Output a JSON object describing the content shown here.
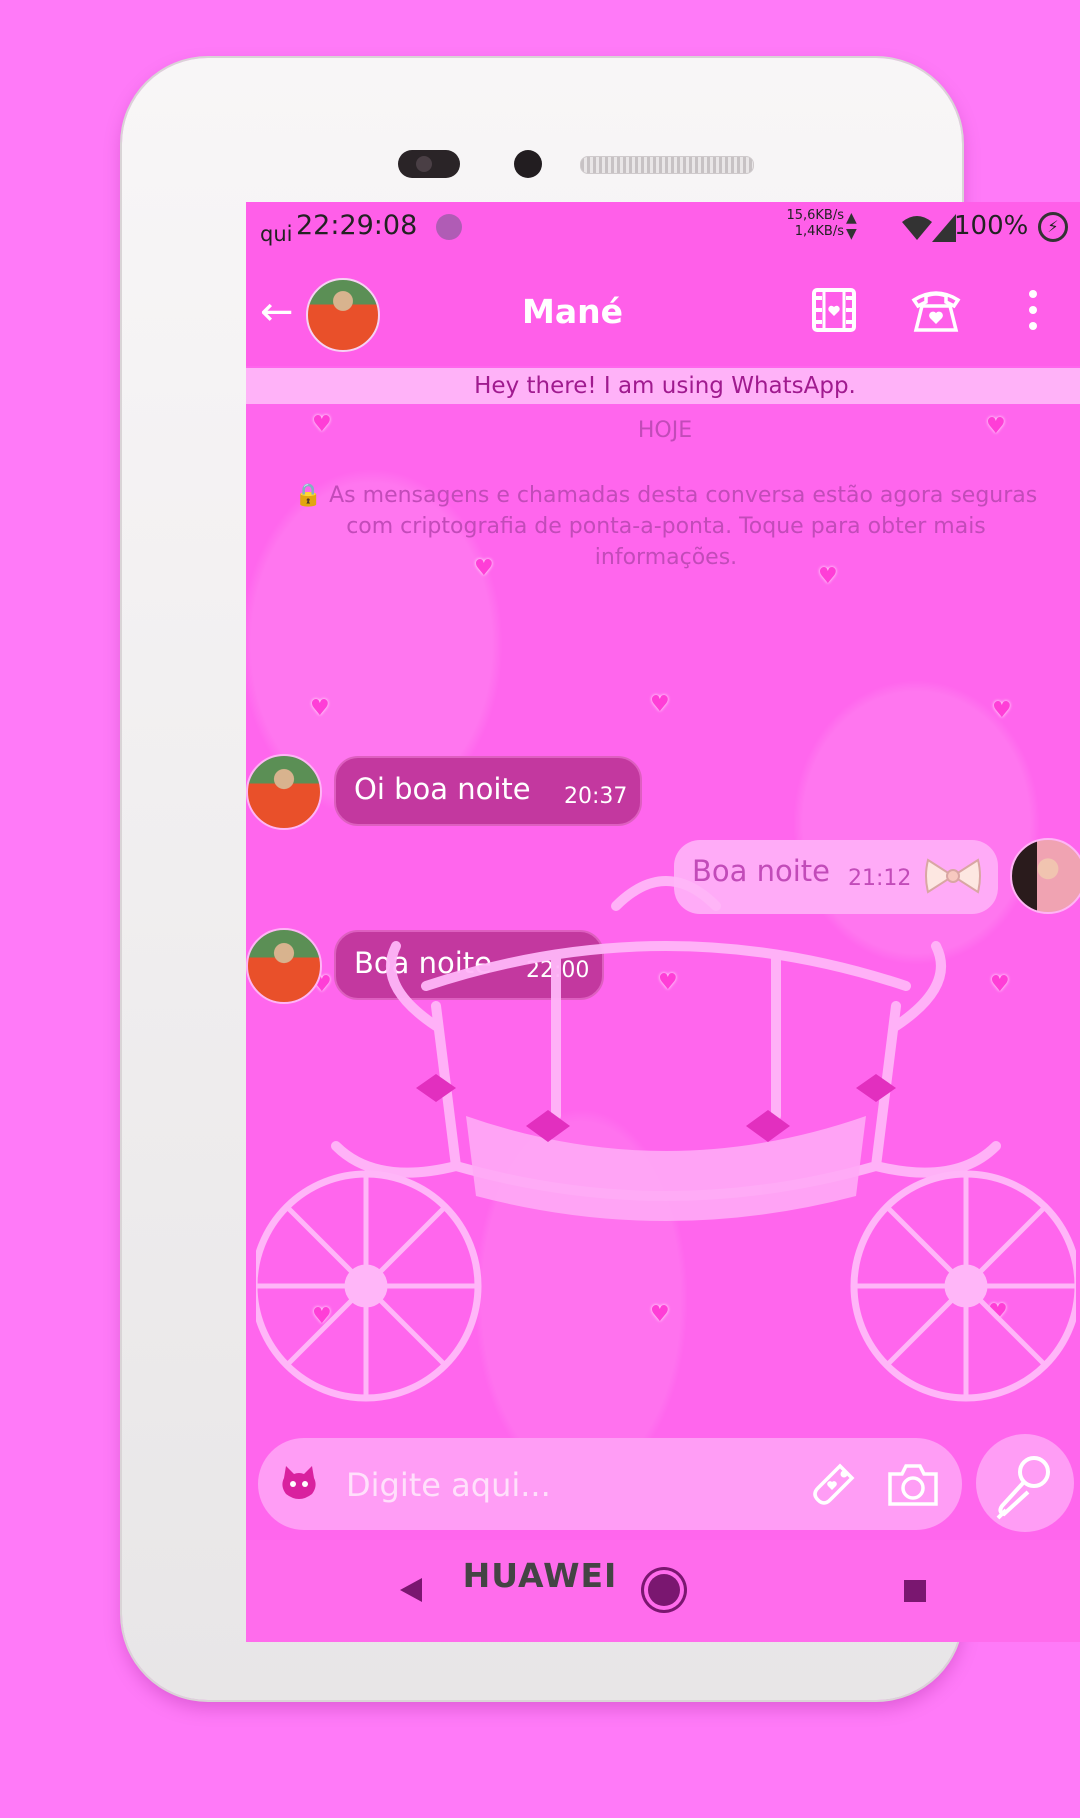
{
  "status_bar": {
    "day": "qui",
    "time": "22:29:08",
    "speed_up": "15,6KB/s",
    "speed_down": "1,4KB/s",
    "battery": "100%"
  },
  "header": {
    "contact_name": "Mané",
    "about": "Hey there! I am using WhatsApp."
  },
  "chat": {
    "date_label": "HOJE",
    "encryption_notice": "🔒 As mensagens e chamadas desta conversa estão agora seguras com criptografia de ponta-a-ponta. Toque para obter mais informações.",
    "messages": [
      {
        "direction": "in",
        "text": "Oi boa noite",
        "time": "20:37"
      },
      {
        "direction": "out",
        "text": "Boa noite",
        "time": "21:12"
      },
      {
        "direction": "in",
        "text": "Boa noite",
        "time": "22:00"
      }
    ]
  },
  "composer": {
    "placeholder": "Digite aqui..."
  },
  "device": {
    "brand": "HUAWEI"
  },
  "icons": {
    "back": "arrow-left-icon",
    "video": "film-icon",
    "call": "telephone-icon",
    "menu": "vertical-dots-icon",
    "emoji": "cat-icon",
    "attach": "attach-tag-icon",
    "camera": "camera-icon",
    "mic": "microphone-icon"
  },
  "colors": {
    "background": "#ff7af8",
    "app_bar": "#ff5fe9",
    "incoming_bubble": "#c3389f",
    "outgoing_bubble": "#ffabf7"
  }
}
